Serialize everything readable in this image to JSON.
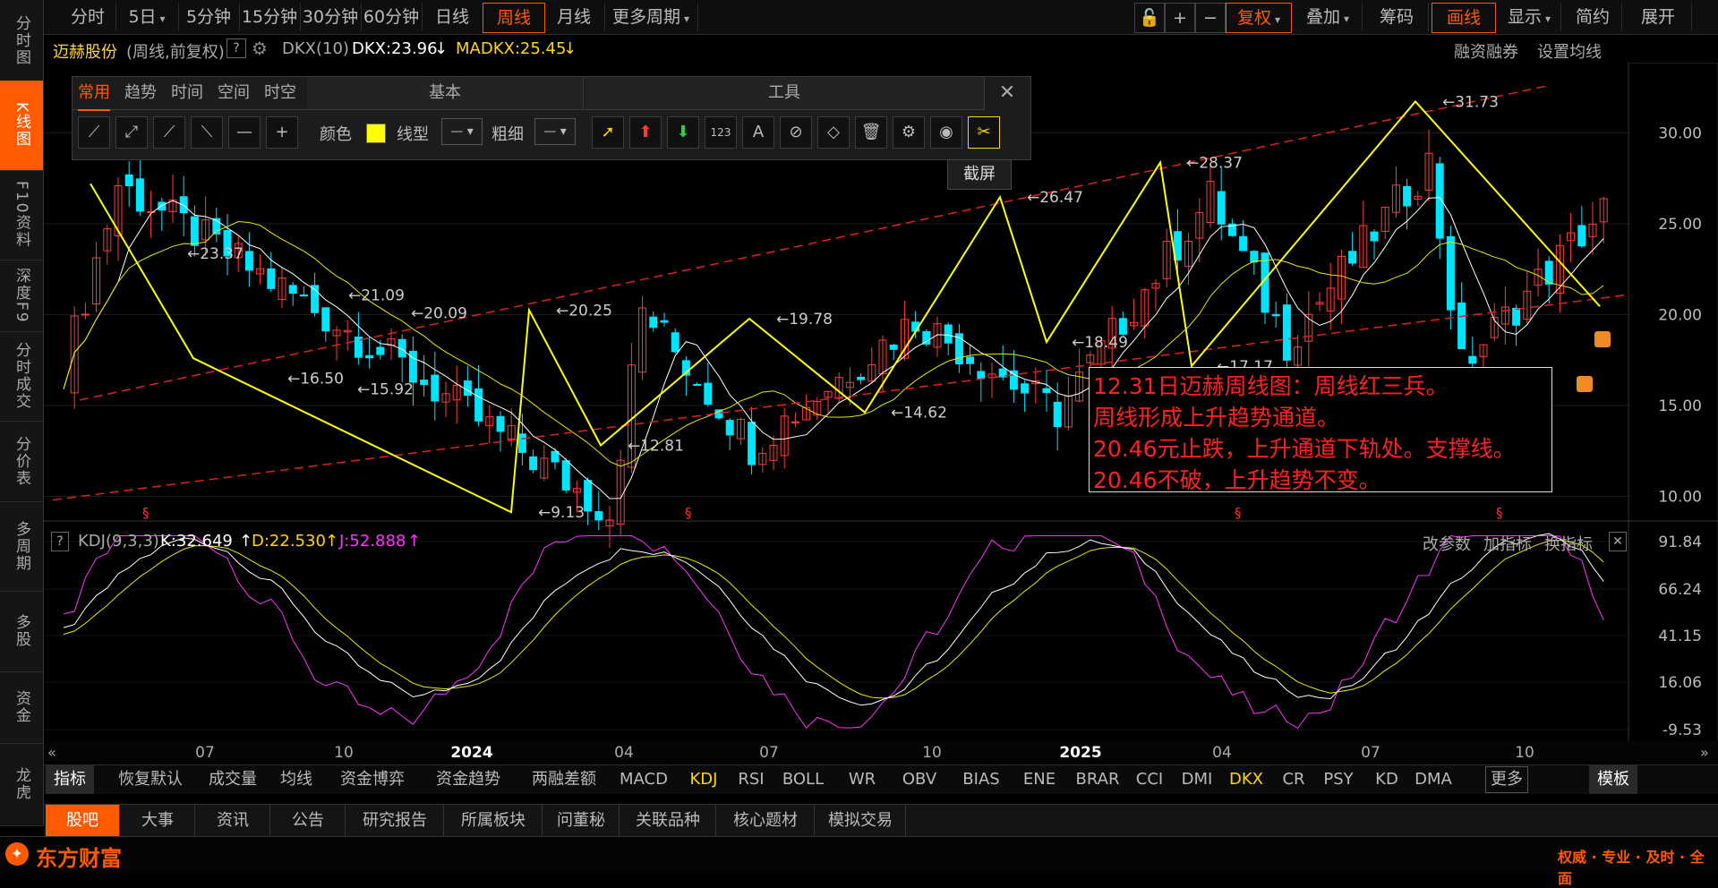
{
  "left_nav": [
    "分时图",
    "K线图",
    "F10资料",
    "深度F9",
    "分时成交",
    "分价表",
    "多周期",
    "多股",
    "资金",
    "龙虎"
  ],
  "left_nav_active": 1,
  "topbar": {
    "periods": [
      "分时",
      "5日",
      "5分钟",
      "15分钟",
      "30分钟",
      "60分钟",
      "日线",
      "周线",
      "月线",
      "更多周期"
    ],
    "active_period": "周线",
    "right_buttons": [
      "复权",
      "叠加",
      "筹码",
      "画线",
      "显示",
      "简约",
      "展开"
    ],
    "active_right": [
      "复权",
      "画线"
    ]
  },
  "info": {
    "stock_name": "迈赫股份",
    "period_desc": "(周线,前复权)",
    "help": "?",
    "indicator": "DKX(10)",
    "dkx": "DKX:23.96",
    "dkx_arrow": "↓",
    "madkx": "MADKX:25.45",
    "madkx_arrow": "↓",
    "right_links": [
      "融资融券",
      "设置均线"
    ]
  },
  "tool_panel": {
    "tabs": [
      "常用",
      "趋势",
      "时间",
      "空间",
      "时空"
    ],
    "active_tab": "常用",
    "section_basic": "基本",
    "section_tools": "工具",
    "color_label": "颜色",
    "line_type_label": "线型",
    "line_width_label": "粗细",
    "tooltip": "截屏",
    "color_value": "#ffff00"
  },
  "annotation": [
    "12.31日迈赫周线图：周线红三兵。",
    "周线形成上升趋势通道。",
    "20.46元止跌，上升通道下轨处。支撑线。",
    "20.46不破，上升趋势不变。"
  ],
  "kdj": {
    "name": "KDJ(9,3,3)",
    "k": "K:32.649",
    "d": "D:22.530",
    "j": "J:52.888",
    "arrow": "↑",
    "right_links": [
      "改参数",
      "加指标",
      "换指标"
    ]
  },
  "indicator_tabs": [
    "指标",
    "恢复默认",
    "成交量",
    "均线",
    "资金博弈",
    "资金趋势",
    "两融差额",
    "MACD",
    "KDJ",
    "RSI",
    "BOLL",
    "WR",
    "OBV",
    "BIAS",
    "ENE",
    "BRAR",
    "CCI",
    "DMI",
    "DKX",
    "CR",
    "PSY",
    "KD",
    "DMA",
    "更多",
    "模板"
  ],
  "bottom_tabs": [
    "股吧",
    "大事",
    "资讯",
    "公告",
    "研究报告",
    "所属板块",
    "问董秘",
    "关联品种",
    "核心题材",
    "模拟交易"
  ],
  "footer": {
    "brand": "东方财富",
    "slogan": "权威 · 专业 · 及时 · 全面"
  },
  "chart_data": {
    "type": "candlestick",
    "price_axis": [
      "30.00",
      "25.00",
      "20.00",
      "15.00",
      "10.00"
    ],
    "kdj_axis": [
      "91.84",
      "66.24",
      "41.15",
      "16.06",
      "-9.53"
    ],
    "time_axis": [
      "07",
      "10",
      "2024",
      "04",
      "07",
      "10",
      "2025",
      "04",
      "07",
      "10"
    ],
    "pivot_labels": [
      {
        "text": "←23.37",
        "price": 23.37
      },
      {
        "text": "←21.09",
        "price": 21.09
      },
      {
        "text": "←20.09",
        "price": 20.09
      },
      {
        "text": "←16.50",
        "price": 16.5
      },
      {
        "text": "←15.92",
        "price": 15.92
      },
      {
        "text": "←20.25",
        "price": 20.25
      },
      {
        "text": "←9.13",
        "price": 9.13
      },
      {
        "text": "←12.81",
        "price": 12.81
      },
      {
        "text": "←19.78",
        "price": 19.78
      },
      {
        "text": "←14.62",
        "price": 14.62
      },
      {
        "text": "←26.47",
        "price": 26.47
      },
      {
        "text": "←18.49",
        "price": 18.49
      },
      {
        "text": "←28.37",
        "price": 28.37
      },
      {
        "text": "←17.17",
        "price": 17.17
      },
      {
        "text": "←31.73",
        "price": 31.73
      }
    ],
    "zigzag_prices": [
      27.2,
      17.6,
      9.13,
      20.25,
      12.81,
      19.78,
      14.62,
      26.47,
      18.49,
      28.37,
      17.17,
      31.73,
      20.46
    ],
    "last_close_approx": 23.5,
    "up_color": "#ff3b3b",
    "down_color": "#00e5ff",
    "zigzag_color": "#ffff00",
    "channel_color": "#e02020",
    "kdj_colors": {
      "k": "#ffffff",
      "d": "#e8e800",
      "j": "#ff33ff"
    }
  }
}
